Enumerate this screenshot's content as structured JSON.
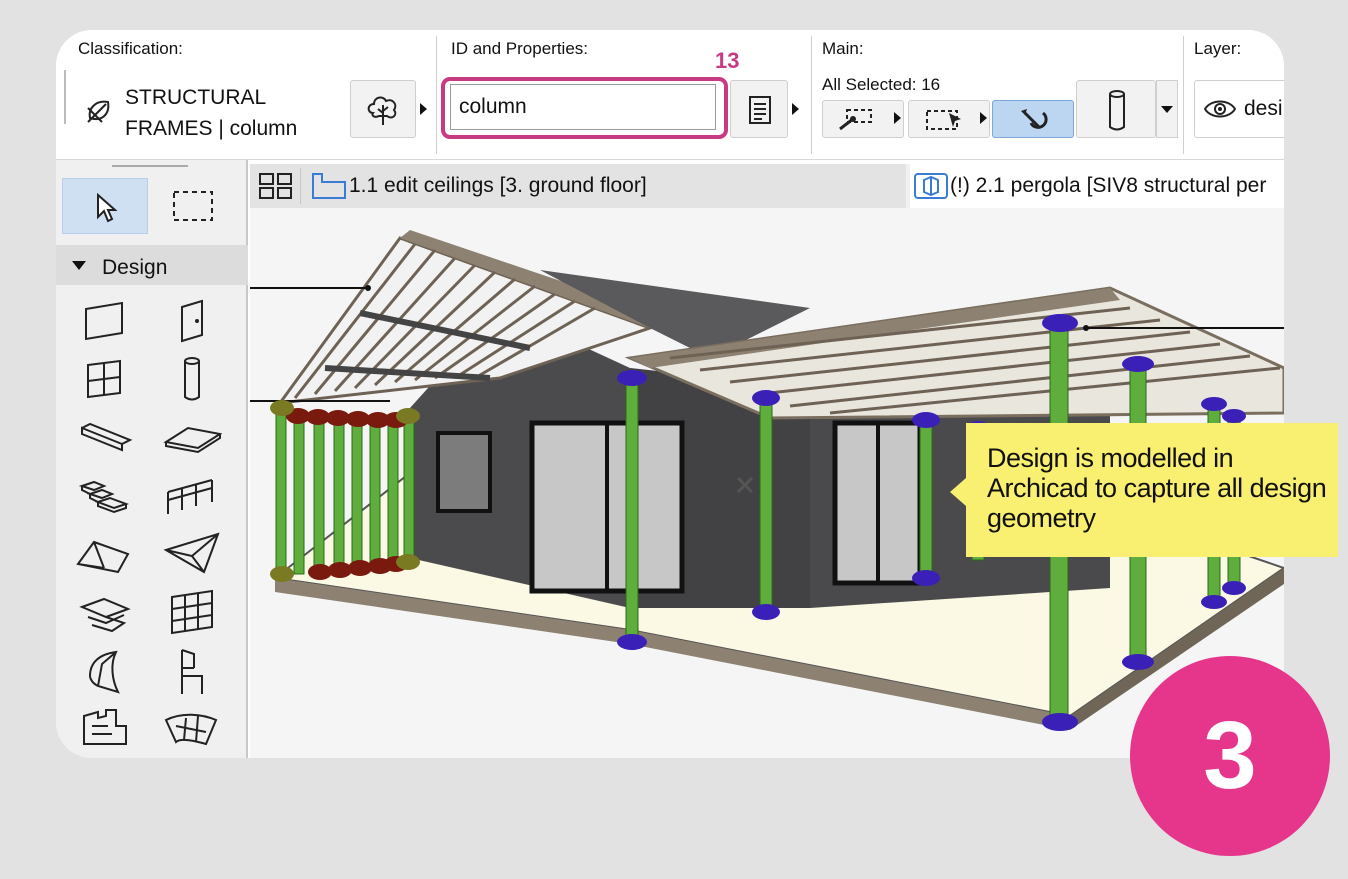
{
  "toolbar": {
    "classification": {
      "title": "Classification:",
      "line1": "STRUCTURAL",
      "line2": "FRAMES | column"
    },
    "id_properties": {
      "title": "ID and Properties:",
      "value": "column",
      "annotation": "13"
    },
    "main": {
      "title": "Main:",
      "selection": "All Selected: 16"
    },
    "layer": {
      "title": "Layer:",
      "value": "desi"
    }
  },
  "sidebar": {
    "section": "Design"
  },
  "tabs": [
    {
      "label": "1.1 edit ceilings [3. ground floor]"
    },
    {
      "label": "(!) 2.1 pergola [SIV8 structural per"
    }
  ],
  "callout": {
    "text": "Design is modelled in Archicad to capture all design geometry"
  },
  "step_badge": "3",
  "colors": {
    "highlight": "#c83b83",
    "step_badge": "#e5368c",
    "callout": "#f9ef70",
    "column_green": "#5fae3d",
    "selection_blue": "#3b20b8"
  }
}
